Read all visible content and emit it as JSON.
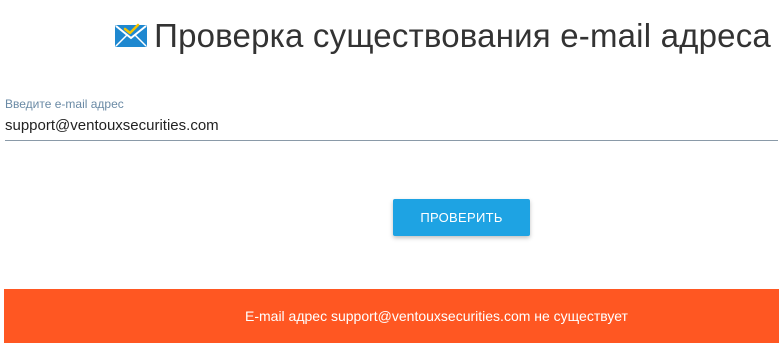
{
  "header": {
    "icon": "envelope-check-icon",
    "title": "Проверка существования e-mail адреса"
  },
  "form": {
    "label": "Введите e-mail адрес",
    "value": "support@ventouxsecurities.com",
    "button_label": "ПРОВЕРИТЬ"
  },
  "result": {
    "message": "E-mail адрес support@ventouxsecurities.com не существует"
  },
  "colors": {
    "icon": "#1e88d0",
    "icon_check": "#f5c400",
    "button": "#1ea3e3",
    "result_bar": "#ff5722",
    "label": "#6a8aa5"
  }
}
